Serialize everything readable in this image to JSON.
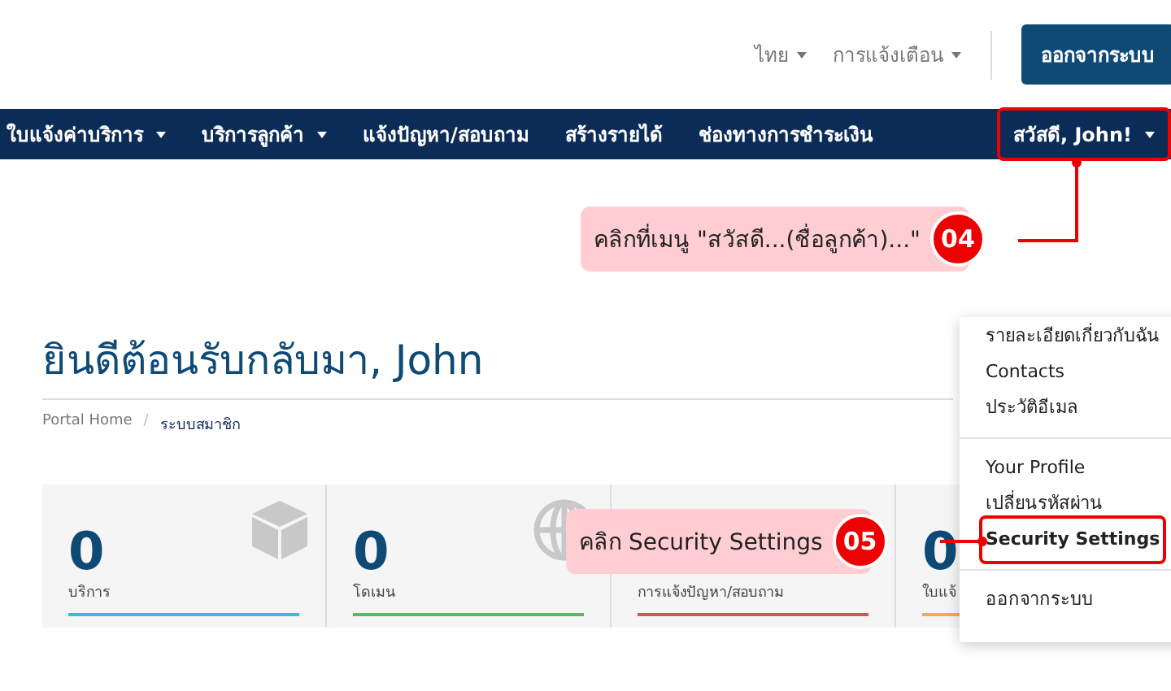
{
  "top_bar": {
    "links": [
      {
        "label": "ไทย",
        "dropdown": true
      },
      {
        "label": "การแจ้งเตือน",
        "dropdown": true
      }
    ],
    "logout_button": "ออกจากระบบ"
  },
  "nav": {
    "items": [
      {
        "label": "ใบแจ้งค่าบริการ",
        "dropdown": true
      },
      {
        "label": "บริการลูกค้า",
        "dropdown": true
      },
      {
        "label": "แจ้งปัญหา/สอบถาม",
        "dropdown": false
      },
      {
        "label": "สร้างรายได้",
        "dropdown": false
      },
      {
        "label": "ช่องทางการชำระเงิน",
        "dropdown": false
      }
    ],
    "user_menu": {
      "label": "สวัสดี, John!",
      "dropdown": true,
      "highlighted": true
    }
  },
  "page": {
    "heading": "ยินดีต้อนรับกลับมา, John",
    "breadcrumb": {
      "home": "Portal Home",
      "separator": "/",
      "current": "ระบบสมาชิก"
    }
  },
  "stats": [
    {
      "value": "0",
      "label": "บริการ",
      "color": "#3cb8dd"
    },
    {
      "value": "0",
      "label": "โดเมน",
      "color": "#5cb85c"
    },
    {
      "label": "การแจ้งปัญหา/สอบถาม",
      "color": "#d9534f"
    },
    {
      "value": "0",
      "label": "ใบแจ้",
      "color": "#f0ad4e"
    }
  ],
  "user_dropdown": {
    "groups": [
      [
        {
          "label": "รายละเอียดเกี่ยวกับฉัน",
          "highlighted": false
        },
        {
          "label": "Contacts",
          "highlighted": false
        },
        {
          "label": "ประวัติอีเมล",
          "highlighted": false
        }
      ],
      [
        {
          "label": "Your Profile",
          "highlighted": false
        },
        {
          "label": "เปลี่ยนรหัสผ่าน",
          "highlighted": false
        },
        {
          "label": "Security Settings",
          "highlighted": true
        }
      ],
      [
        {
          "label": "ออกจากระบบ",
          "highlighted": false
        }
      ]
    ]
  },
  "callouts": [
    {
      "step": "04",
      "text": "คลิกที่เมนู \"สวัสดี...(ชื่อลูกค้า)...\""
    },
    {
      "step": "05",
      "text": "คลิก Security Settings"
    }
  ]
}
